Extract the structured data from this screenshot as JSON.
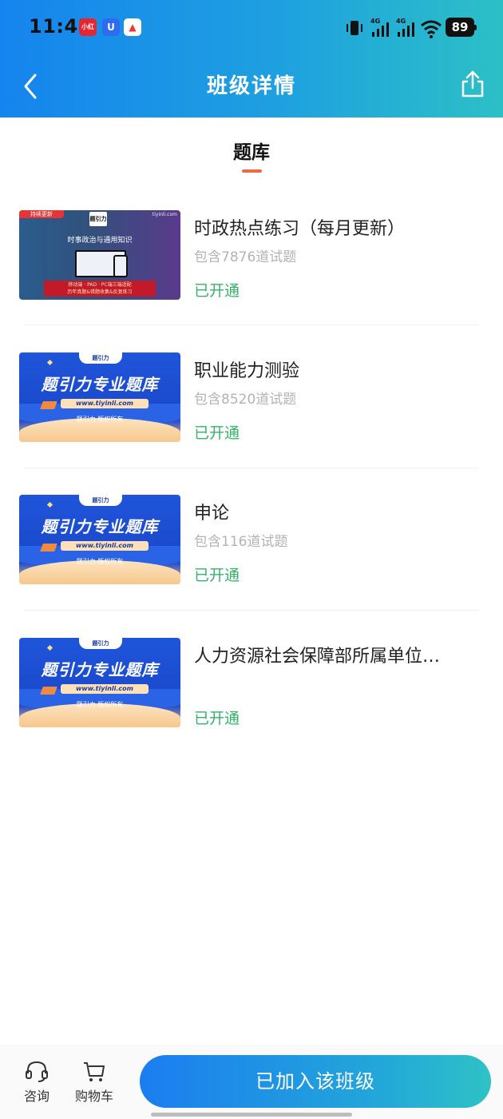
{
  "status_bar": {
    "time": "11:43",
    "notifications": [
      "小红书",
      "U",
      "▲"
    ],
    "battery": "89",
    "network_labels": [
      "4G",
      "4G"
    ]
  },
  "header": {
    "title": "班级详情",
    "back_icon": "chevron-left-icon",
    "share_icon": "share-icon"
  },
  "tabs": [
    {
      "label": "题库",
      "active": true
    }
  ],
  "banner_text": {
    "blue_logo": "题引力",
    "blue_title": "题引力专业题库",
    "blue_url": "www.tiyinli.com",
    "blue_copyright": "题引力 版权所有",
    "purple_tag": "持续更新",
    "purple_logo": "题引力",
    "purple_site": "tiyinli.com",
    "purple_subtitle": "时事政治与通用知识",
    "purple_line1": "移动端 · PAD · PC端三端适配",
    "purple_line2": "历年真题&错题收集&反复练习"
  },
  "items": [
    {
      "title": "时政热点练习（每月更新）",
      "count": "包含7876道试题",
      "status": "已开通",
      "thumb": "purple"
    },
    {
      "title": "职业能力测验",
      "count": "包含8520道试题",
      "status": "已开通",
      "thumb": "blue"
    },
    {
      "title": "申论",
      "count": "包含116道试题",
      "status": "已开通",
      "thumb": "blue"
    },
    {
      "title": "人力资源社会保障部所属单位…",
      "count": "",
      "status": "已开通",
      "thumb": "blue"
    }
  ],
  "bottom_bar": {
    "consult_label": "咨询",
    "consult_icon": "headset-icon",
    "cart_label": "购物车",
    "cart_icon": "cart-icon",
    "join_label": "已加入该班级"
  },
  "colors": {
    "header_gradient_start": "#1584ee",
    "header_gradient_end": "#2cc0c6",
    "tab_underline": "#ee6a3c",
    "status_green": "#34b36a",
    "count_gray": "#b3b3b3"
  }
}
